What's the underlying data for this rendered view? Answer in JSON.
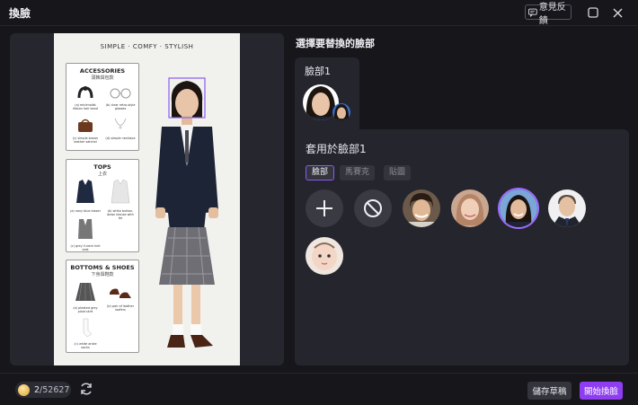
{
  "window": {
    "title": "換臉",
    "feedback_label": "意見反饋"
  },
  "preview": {
    "header": "SIMPLE · COMFY · STYLISH",
    "sections": [
      {
        "title": "ACCESSORIES",
        "subtitle": "頭飾與包款",
        "items": [
          "(a) minimalist ribbon hair band",
          "(b) clear retro-style glasses",
          "(c) simple brown leather satchel",
          "(d) simple necklace"
        ]
      },
      {
        "title": "TOPS",
        "subtitle": "上衣",
        "items": [
          "(a) navy blue blazer",
          "(b) white button-down blouse with tie",
          "(c) grey V-neck knit vest"
        ]
      },
      {
        "title": "BOTTOMS & SHOES",
        "subtitle": "下身與鞋款",
        "items": [
          "(a) pleated grey plaid skirt",
          "(b) pair of leather loafers",
          "(c) white ankle socks"
        ]
      }
    ]
  },
  "right": {
    "select_title": "選擇要替換的臉部",
    "face_label": "臉部1",
    "apply_title": "套用於臉部1",
    "tabs": [
      "臉部",
      "馬賽克",
      "貼圖"
    ],
    "active_tab": "臉部"
  },
  "footer": {
    "credits_used": "2",
    "credits_total": "/52627",
    "save_label": "儲存草稿",
    "start_label": "開始換臉"
  },
  "colors": {
    "accent": "#8f3df0",
    "selected_ring": "#9d6bff"
  }
}
